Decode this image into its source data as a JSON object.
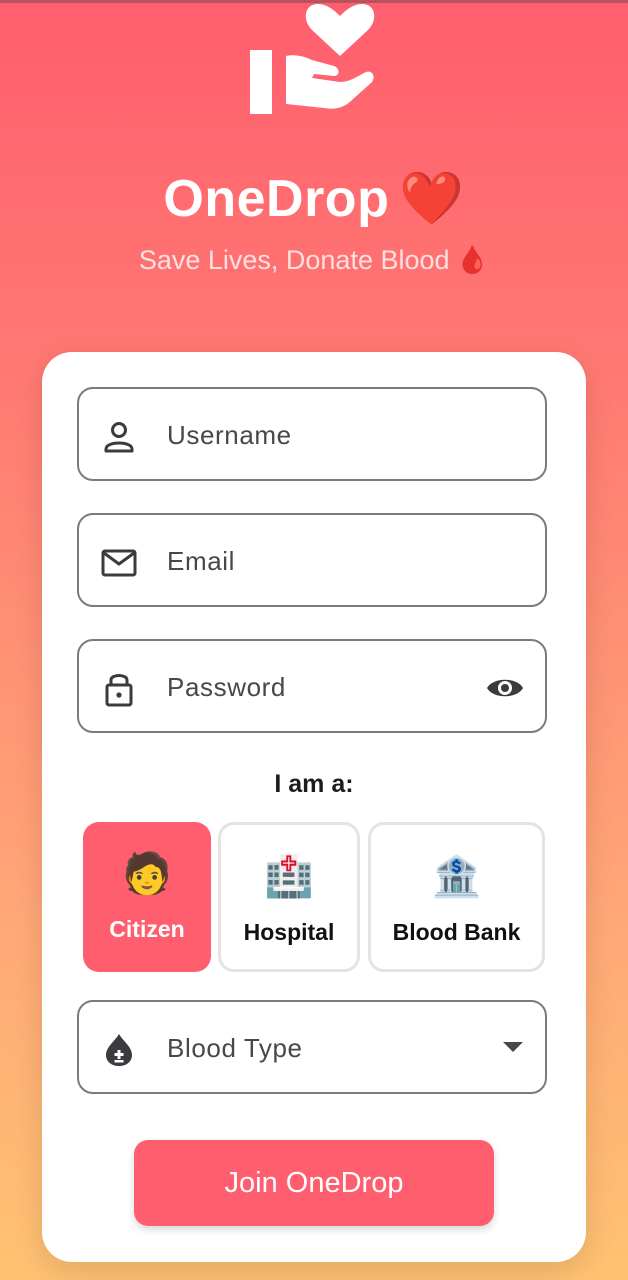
{
  "app": {
    "title": "OneDrop",
    "title_emoji": "❤️",
    "tagline": "Save Lives, Donate Blood",
    "tagline_emoji": "🩸",
    "logo_icon": "hand-holding-heart-icon"
  },
  "form": {
    "username_placeholder": "Username",
    "email_placeholder": "Email",
    "password_placeholder": "Password",
    "role_prompt": "I am a:",
    "roles": [
      {
        "label": "Citizen",
        "emoji": "🧑",
        "selected": true
      },
      {
        "label": "Hospital",
        "emoji": "🏥",
        "selected": false
      },
      {
        "label": "Blood Bank",
        "emoji": "🏦",
        "selected": false
      }
    ],
    "blood_type_label": "Blood Type",
    "submit_label": "Join OneDrop"
  },
  "colors": {
    "accent": "#FF5E6E",
    "gradient_top": "#FF5E6E",
    "gradient_bottom": "#FFC272",
    "heart": "#e0222c"
  }
}
